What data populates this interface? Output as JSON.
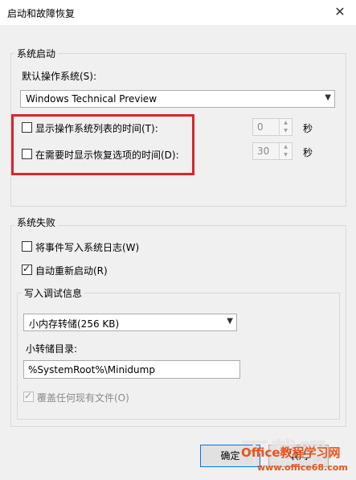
{
  "window": {
    "title": "启动和故障恢复",
    "close_glyph": "✕"
  },
  "startup": {
    "legend": "系统启动",
    "default_os_label": "默认操作系统(S):",
    "default_os_value": "Windows Technical Preview",
    "show_os_list": {
      "label": "显示操作系统列表的时间(T):",
      "checked": false,
      "value": "0",
      "unit": "秒"
    },
    "show_recovery": {
      "label": "在需要时显示恢复选项的时间(D):",
      "checked": false,
      "value": "30",
      "unit": "秒"
    }
  },
  "failure": {
    "legend": "系统失败",
    "write_event": {
      "label": "将事件写入系统日志(W)",
      "checked": false
    },
    "auto_restart": {
      "label": "自动重新启动(R)",
      "checked": true
    },
    "debug": {
      "legend": "写入调试信息",
      "dump_type": "小内存转储(256 KB)",
      "dump_dir_label": "小转储目录:",
      "dump_dir_value": "%SystemRoot%\\Minidump",
      "overwrite": {
        "label": "覆盖任何现有文件(O)",
        "checked": true,
        "disabled": true
      }
    }
  },
  "buttons": {
    "ok": "确定",
    "cancel": "取消"
  },
  "watermark": {
    "brand": "Office教程学习网",
    "url": "www.office68.com",
    "bg": "下载吧"
  },
  "colors": {
    "highlight_box": "#d7262b",
    "watermark": "#e8541a"
  }
}
